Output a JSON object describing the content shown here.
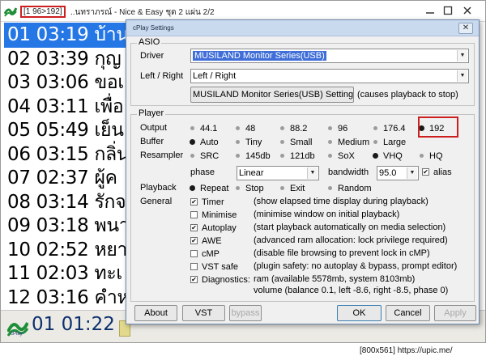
{
  "main_window": {
    "title_prefix": "[1 96>192]",
    "title": "..นทราภรณ์ - Nice & Easy ชุด 2 แผ่น 2/2",
    "tracks": [
      {
        "text": "01 03:19 บ้าน",
        "selected": true
      },
      {
        "text": "02 03:39 กุญ",
        "selected": false
      },
      {
        "text": "03 03:06 ขอเ",
        "selected": false
      },
      {
        "text": "04 03:11 เพื่อ",
        "selected": false
      },
      {
        "text": "05 05:49 เย็น",
        "selected": false
      },
      {
        "text": "06 03:15 กลิ่น",
        "selected": false
      },
      {
        "text": "07 02:37 ผู้ค",
        "selected": false
      },
      {
        "text": "08 03:14 รักจ",
        "selected": false
      },
      {
        "text": "09 03:18 พนา",
        "selected": false
      },
      {
        "text": "10 02:52 หยา",
        "selected": false
      },
      {
        "text": "11 02:03 ทะเ",
        "selected": false
      },
      {
        "text": "12 03:16 คำห",
        "selected": false
      }
    ],
    "now_playing": "01 01:22",
    "logo_text": "cPlay",
    "selection_color": "#2577e6"
  },
  "dialog": {
    "title": "cPlay Settings",
    "close_glyph": "✕",
    "asio": {
      "group_label": "ASIO",
      "driver_label": "Driver",
      "driver_value": "MUSILAND Monitor Series(USB)",
      "lr_label": "Left / Right",
      "lr_value": "Left / Right",
      "settings_button": "MUSILAND Monitor Series(USB) Setting",
      "settings_note": "(causes playback to stop)"
    },
    "player": {
      "group_label": "Player",
      "output_label": "Output",
      "output_options": [
        "44.1",
        "48",
        "88.2",
        "96",
        "176.4",
        "192"
      ],
      "output_selected": "192",
      "buffer_label": "Buffer",
      "buffer_options": [
        "Auto",
        "Tiny",
        "Small",
        "Medium",
        "Large"
      ],
      "buffer_selected": "Auto",
      "resampler_label": "Resampler",
      "resampler_options": [
        "SRC",
        "145db",
        "121db",
        "SoX",
        "VHQ",
        "HQ"
      ],
      "resampler_selected": "VHQ",
      "phase_label": "phase",
      "phase_value": "Linear",
      "bandwidth_label": "bandwidth",
      "bandwidth_value": "95.0",
      "alias_label": "alias",
      "alias_checked": true,
      "playback_label": "Playback",
      "playback_options": [
        "Repeat",
        "Stop",
        "Exit",
        "Random"
      ],
      "playback_selected": "Repeat",
      "general_label": "General",
      "general_options": [
        {
          "label": "Timer",
          "checked": true,
          "desc": "(show elapsed time display during playback)"
        },
        {
          "label": "Minimise",
          "checked": false,
          "desc": "(minimise window on initial playback)"
        },
        {
          "label": "Autoplay",
          "checked": true,
          "desc": "(start playback automatically on media selection)"
        },
        {
          "label": "AWE",
          "checked": true,
          "desc": "(advanced ram allocation: lock privilege required)"
        },
        {
          "label": "cMP",
          "checked": false,
          "desc": "(disable file browsing to prevent lock in cMP)"
        },
        {
          "label": "VST safe",
          "checked": false,
          "desc": "(plugin safety: no autoplay & bypass, prompt editor)"
        },
        {
          "label": "Diagnostics:",
          "checked": true,
          "desc": "ram (available 5578mb, system 8103mb)"
        }
      ],
      "volume_text": "volume (balance  0.1, left -8.6, right -8.5, phase 0)"
    },
    "buttons": {
      "about": "About",
      "vst": "VST",
      "bypass": "bypass",
      "ok": "OK",
      "cancel": "Cancel",
      "apply": "Apply"
    }
  },
  "footer": {
    "resolution_text": "[800x561] https://upic.me/"
  }
}
